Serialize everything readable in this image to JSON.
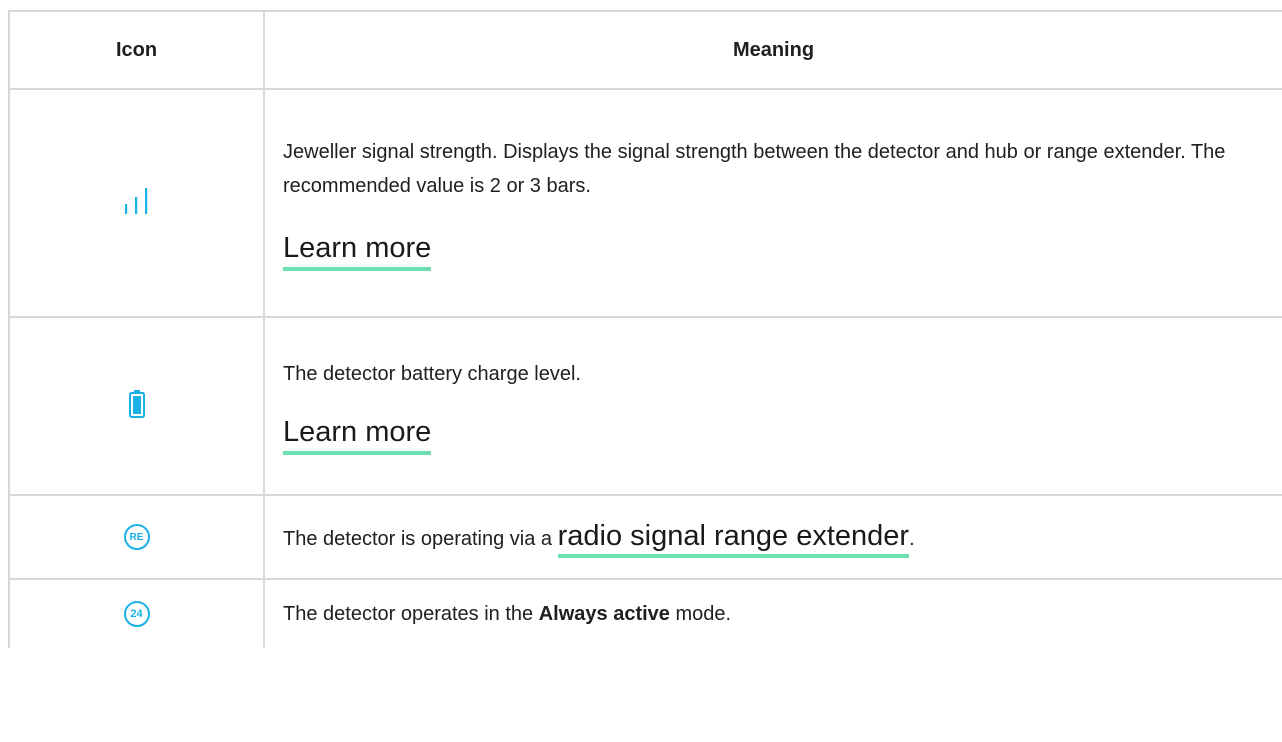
{
  "table": {
    "headers": {
      "icon": "Icon",
      "meaning": "Meaning"
    },
    "rows": [
      {
        "icon_name": "signal-strength-icon",
        "text": "Jeweller signal strength. Displays the signal strength between the detector and hub or range extender. The recommended value is 2 or 3 bars.",
        "link": "Learn more"
      },
      {
        "icon_name": "battery-icon",
        "text": "The detector battery charge level.",
        "link": "Learn more"
      },
      {
        "icon_name": "range-extender-icon",
        "icon_text": "RE",
        "text_before": "The detector is operating via a ",
        "link": "radio signal range extender",
        "text_after": "."
      },
      {
        "icon_name": "always-active-icon",
        "icon_text": "24",
        "text_before": "The detector operates in the ",
        "bold": "Always active",
        "text_after": " mode."
      }
    ]
  },
  "colors": {
    "icon_accent": "#19b1e6",
    "link_underline": "#6ee0b0",
    "border": "#d8d8d8"
  }
}
